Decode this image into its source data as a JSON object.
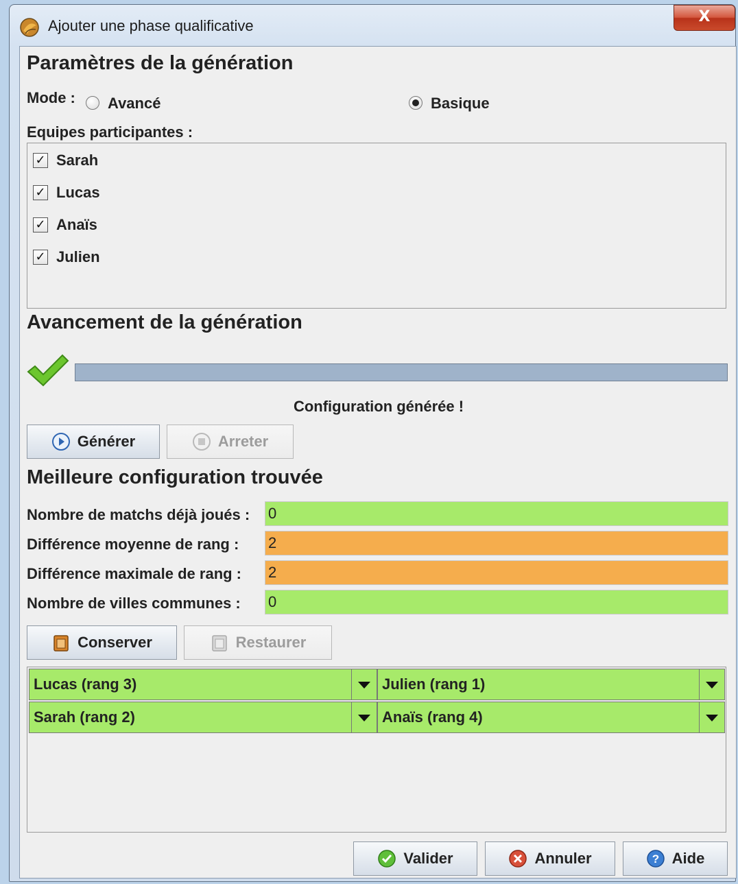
{
  "window": {
    "title": "Ajouter une phase qualificative",
    "close_label": "X"
  },
  "params": {
    "title": "Paramètres de la génération",
    "mode_label": "Mode :",
    "mode_options": [
      {
        "label": "Avancé",
        "checked": false
      },
      {
        "label": "Basique",
        "checked": true
      }
    ],
    "teams_label": "Equipes participantes :",
    "teams": [
      {
        "name": "Sarah",
        "checked": true
      },
      {
        "name": "Lucas",
        "checked": true
      },
      {
        "name": "Anaïs",
        "checked": true
      },
      {
        "name": "Julien",
        "checked": true
      }
    ]
  },
  "progress": {
    "title": "Avancement de la génération",
    "value": 1.0,
    "status": "Configuration générée !",
    "generate_label": "Générer",
    "stop_label": "Arreter"
  },
  "best": {
    "title": "Meilleure configuration trouvée",
    "fields": [
      {
        "label": "Nombre de matchs déjà joués :",
        "value": "0",
        "color": "#a7ea6a"
      },
      {
        "label": "Différence moyenne de rang :",
        "value": "2",
        "color": "#f5ad4d"
      },
      {
        "label": "Différence maximale de rang :",
        "value": "2",
        "color": "#f5ad4d"
      },
      {
        "label": "Nombre de villes communes :",
        "value": "0",
        "color": "#a7ea6a"
      }
    ],
    "keep_label": "Conserver",
    "restore_label": "Restaurer",
    "matches": [
      {
        "left": "Lucas (rang 3)",
        "right": "Julien (rang 1)"
      },
      {
        "left": "Sarah (rang 2)",
        "right": "Anaïs (rang 4)"
      }
    ]
  },
  "footer": {
    "validate_label": "Valider",
    "cancel_label": "Annuler",
    "help_label": "Aide"
  },
  "colors": {
    "good": "#a7ea6a",
    "warn": "#f5ad4d",
    "progress": "#9fb3ca"
  }
}
